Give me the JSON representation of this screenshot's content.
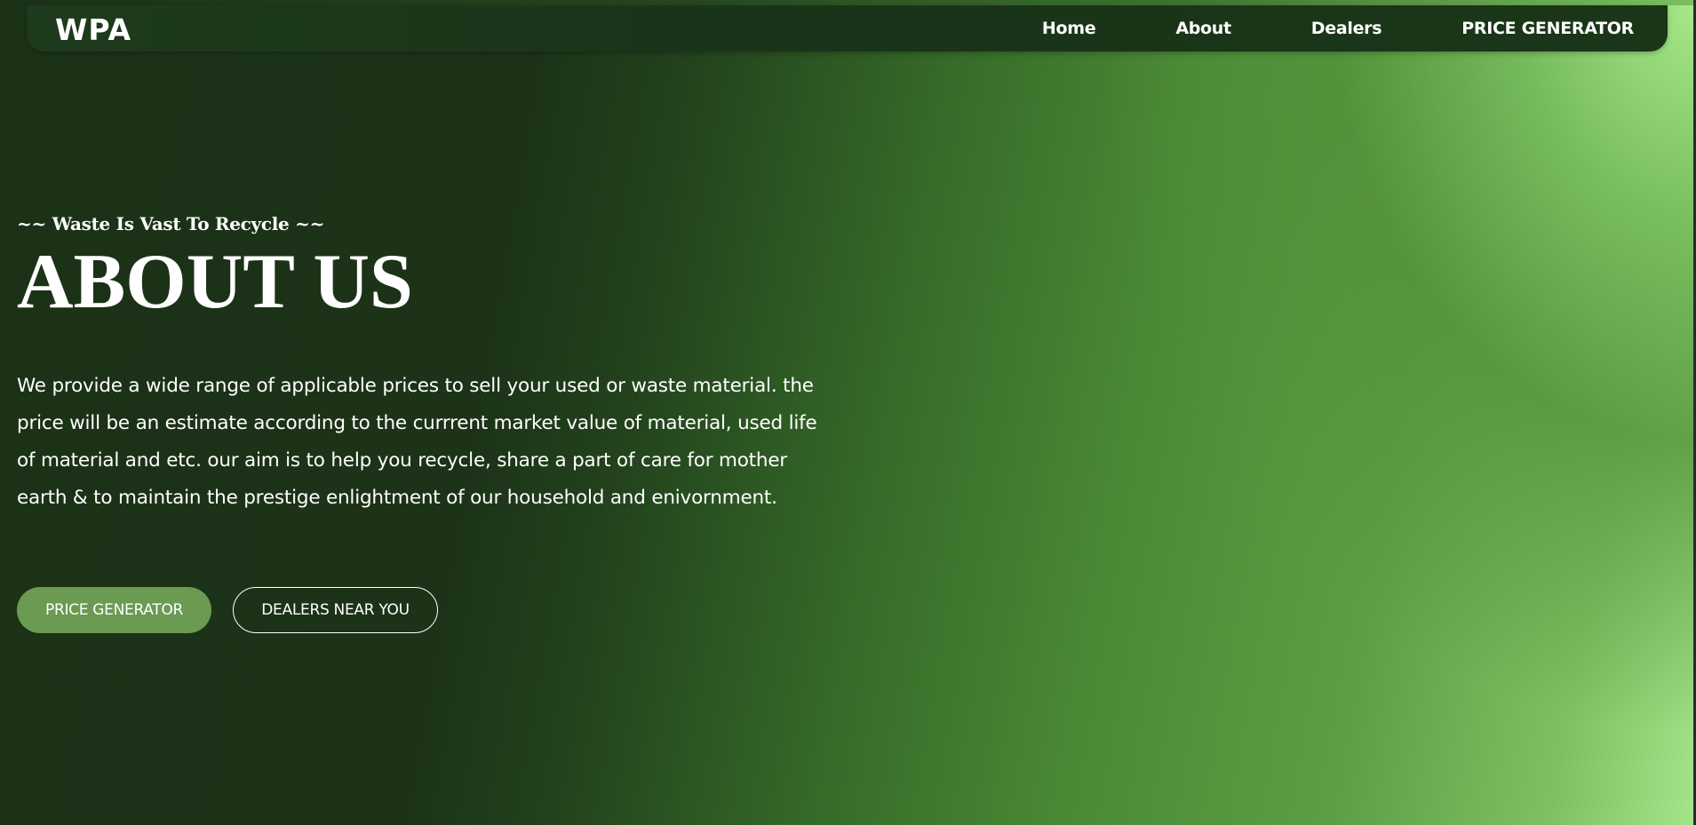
{
  "brand": {
    "logo": "WPA"
  },
  "nav": {
    "items": [
      {
        "label": "Home"
      },
      {
        "label": "About"
      },
      {
        "label": "Dealers"
      },
      {
        "label": "PRICE GENERATOR"
      }
    ]
  },
  "hero": {
    "tagline": "~~ Waste Is Vast To Recycle ~~",
    "title": "ABOUT US",
    "description": "We provide a wide range of applicable prices to sell your used or waste material. the price will be an estimate according to the currrent market value of material, used life of material and etc. our aim is to help you recycle, share a part of care for mother earth & to maintain the prestige enlightment of our household and enivornment.",
    "buttons": {
      "primary": "PRICE GENERATOR",
      "secondary": "DEALERS NEAR YOU"
    }
  },
  "colors": {
    "navbar": "#1b3518",
    "primary_button": "#6b9a52",
    "gradient_dark": "#1b3217",
    "gradient_light": "#a4e58a"
  }
}
